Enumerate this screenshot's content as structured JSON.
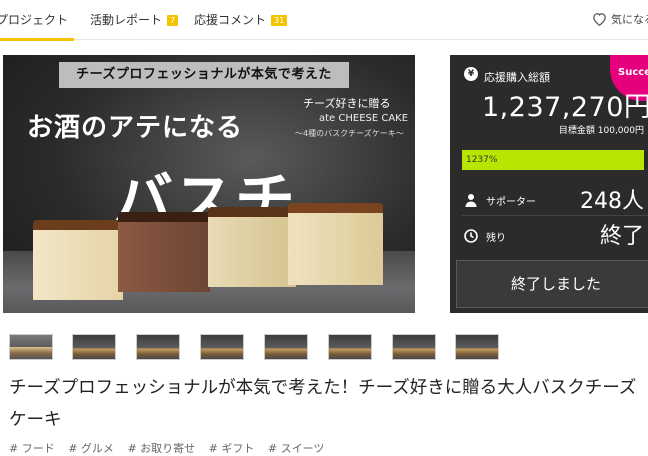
{
  "tabs": {
    "project": "プロジェクト",
    "reports": "活動レポート",
    "reports_count": "7",
    "comments": "応援コメント",
    "comments_count": "31",
    "favorite": "気になる"
  },
  "hero": {
    "banner": "チーズプロフェッショナルが本気で考えた",
    "line1": "お酒のアテになる",
    "line2": "バスチー。",
    "sub1": "チーズ好きに贈る",
    "sub2": "ate CHEESE CAKE",
    "sub3": "～4種のバスクチーズケーキ～"
  },
  "panel": {
    "success_badge": "Succe",
    "total_label": "応援購入総額",
    "yen_icon": "¥",
    "amount": "1,237,270円",
    "goal": "目標金額 100,000円",
    "progress_label": "1237%",
    "progress_percent": 1237,
    "supporters_label": "サポーター",
    "supporters_value": "248人",
    "remaining_label": "残り",
    "remaining_value": "終了",
    "ended_button": "終了しました",
    "accent_color": "#b8e600",
    "badge_color": "#e6007e"
  },
  "thumbnails": [
    "thumb-1",
    "thumb-2",
    "thumb-3",
    "thumb-4",
    "thumb-5",
    "thumb-6",
    "thumb-7",
    "thumb-8"
  ],
  "title": "チーズプロフェッショナルが本気で考えた！チーズ好きに贈る大人バスクチーズケーキ",
  "tags": [
    "# フード",
    "# グルメ",
    "# お取り寄せ",
    "# ギフト",
    "# スイーツ"
  ]
}
